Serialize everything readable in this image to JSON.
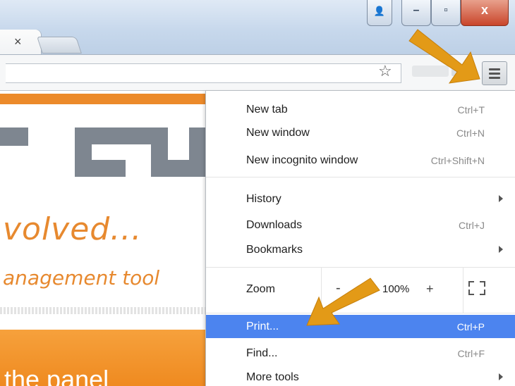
{
  "window": {
    "tab_close_glyph": "×",
    "controls": {
      "user_glyph": "👤",
      "minimize_glyph": "–",
      "maximize_glyph": "▫",
      "close_glyph": "x"
    }
  },
  "toolbar": {
    "star_glyph": "☆"
  },
  "page": {
    "headline": "volved...",
    "tagline": "anagement tool",
    "panel_text": "the panel"
  },
  "menu": {
    "items": [
      {
        "label": "New tab",
        "shortcut": "Ctrl+T"
      },
      {
        "label": "New window",
        "shortcut": "Ctrl+N"
      },
      {
        "label": "New incognito window",
        "shortcut": "Ctrl+Shift+N"
      },
      {
        "label": "History",
        "shortcut": ""
      },
      {
        "label": "Downloads",
        "shortcut": "Ctrl+J"
      },
      {
        "label": "Bookmarks",
        "shortcut": ""
      },
      {
        "label": "Print...",
        "shortcut": "Ctrl+P"
      },
      {
        "label": "Find...",
        "shortcut": "Ctrl+F"
      },
      {
        "label": "More tools",
        "shortcut": ""
      }
    ],
    "zoom": {
      "label": "Zoom",
      "minus": "-",
      "value": "100%",
      "plus": "+"
    }
  },
  "colors": {
    "accent_orange": "#e7892f",
    "arrow_orange": "#e39a17",
    "menu_highlight": "#4c84ef"
  }
}
